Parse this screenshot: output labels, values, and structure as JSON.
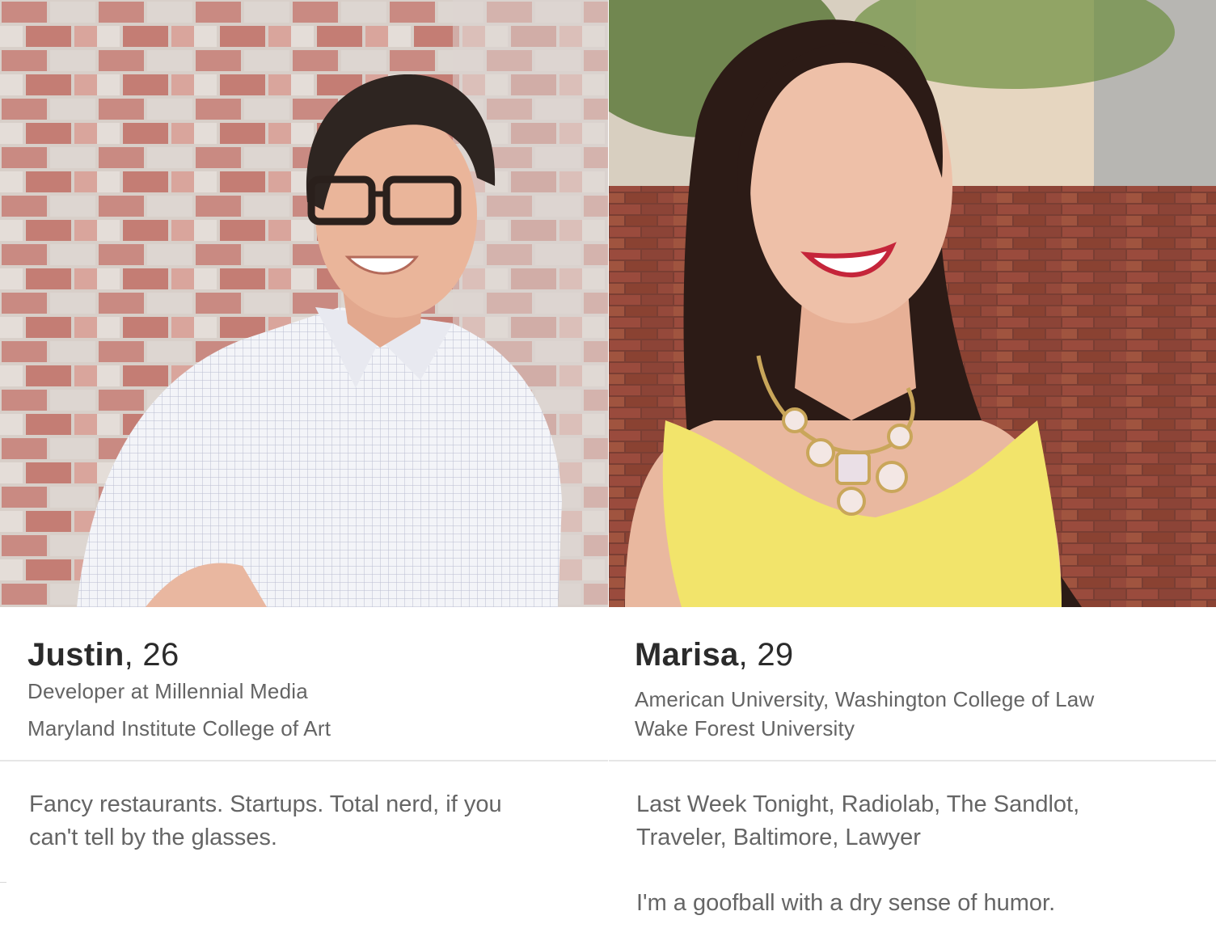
{
  "profiles": [
    {
      "name": "Justin",
      "age_text": ", 26",
      "lines": [
        "Developer at Millennial Media",
        "Maryland Institute College of Art"
      ],
      "bio": [
        "Fancy restaurants. Startups. Total nerd, if you",
        "can't tell by the glasses."
      ]
    },
    {
      "name": "Marisa",
      "age_text": ", 29",
      "lines": [
        "American University, Washington College of Law",
        "Wake Forest University"
      ],
      "bio": [
        "Last Week Tonight, Radiolab, The Sandlot,",
        "Traveler, Baltimore, Lawyer",
        "I'm a goofball with a dry sense of humor."
      ]
    }
  ],
  "colors": {
    "name_text": "#2b2b2b",
    "meta_text": "#646464",
    "bio_text": "#656565",
    "divider": "#e6e6e6"
  }
}
